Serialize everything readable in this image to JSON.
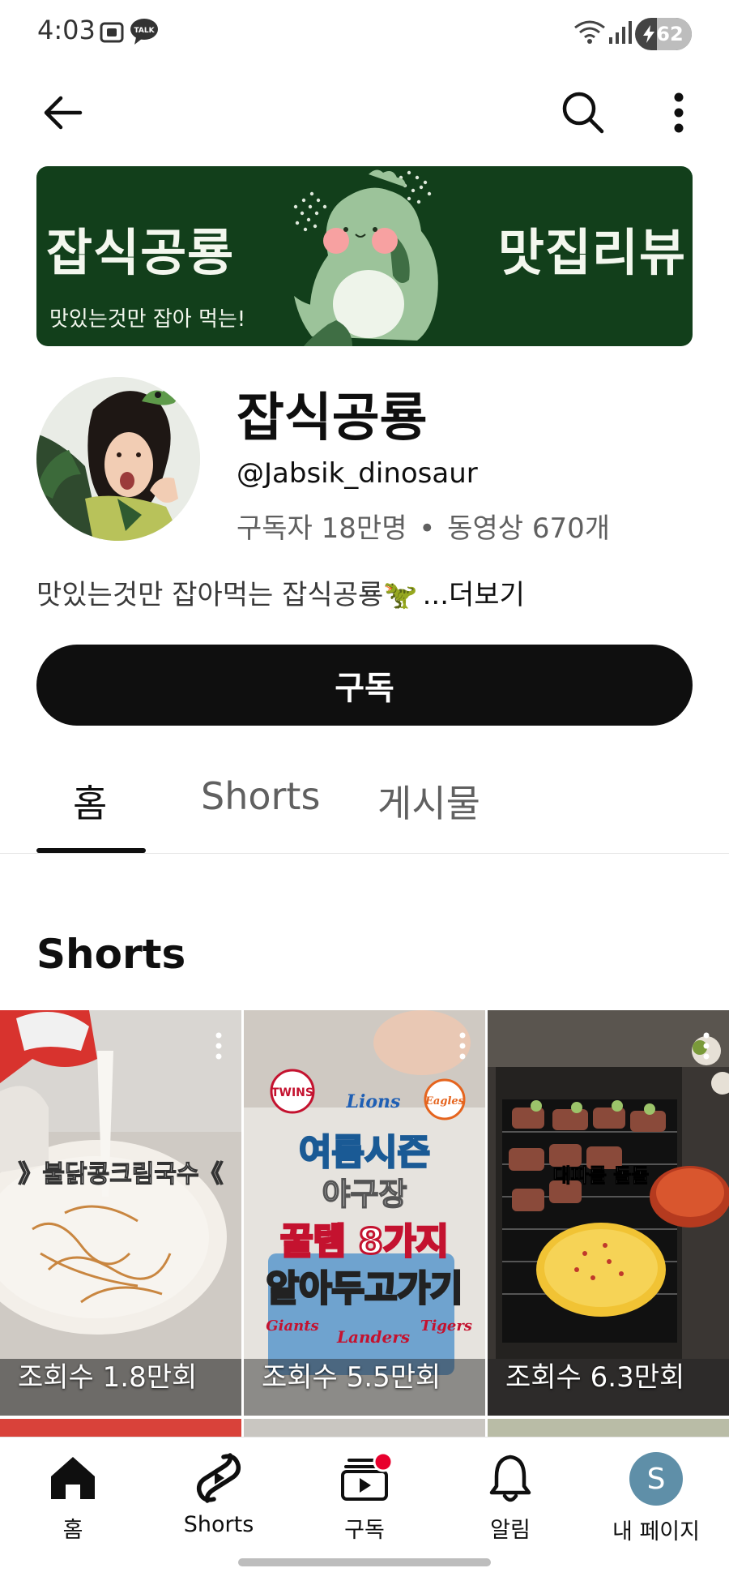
{
  "status_bar": {
    "time": "4:03",
    "battery_level": "62",
    "notif_icons": [
      "screenshot-icon",
      "kakaotalk-icon"
    ],
    "talk_badge": "TALK"
  },
  "top_bar": {
    "icons": [
      "back-arrow-icon",
      "search-icon",
      "more-vert-icon"
    ]
  },
  "banner": {
    "title_left": "잡식공룡",
    "title_right": "맛집리뷰",
    "tagline": "맛있는것만 잡아 먹는!"
  },
  "channel": {
    "name": "잡식공룡",
    "handle": "@Jabsik_dinosaur",
    "subscribers": "구독자 18만명",
    "separator": "•",
    "videos": "동영상 670개",
    "description": "맛있는것만 잡아먹는 잡식공룡🦖",
    "more_label": "...더보기"
  },
  "subscribe": {
    "label": "구독"
  },
  "tabs": [
    {
      "label": "홈",
      "active": true
    },
    {
      "label": "Shorts",
      "active": false
    },
    {
      "label": "게시물",
      "active": false
    }
  ],
  "shorts_section": {
    "title": "Shorts",
    "items": [
      {
        "views": "조회수 1.8만회",
        "overlay_text": "》불닭콩크림국수《"
      },
      {
        "views": "조회수 5.5만회",
        "overlay_lines": [
          "여름시즌",
          "야구장",
          "꿀템 8가지",
          "알아두고가기"
        ],
        "logos": [
          "TWINS",
          "Lions",
          "Eagles",
          "Giants",
          "Landers",
          "Tigers"
        ]
      },
      {
        "views": "조회수 6.3만회",
        "overlay_text": "대파를 돌돌"
      }
    ]
  },
  "bottom_nav": [
    {
      "label": "홈",
      "icon": "home-icon"
    },
    {
      "label": "Shorts",
      "icon": "shorts-icon"
    },
    {
      "label": "구독",
      "icon": "subscriptions-icon",
      "badge": true
    },
    {
      "label": "알림",
      "icon": "bell-icon"
    },
    {
      "label": "내 페이지",
      "icon": "avatar",
      "avatar_letter": "S"
    }
  ],
  "colors": {
    "banner_bg": "#123f1b",
    "subscribe_bg": "#0f0f0f",
    "badge": "#e8002d",
    "avatar_bg": "#5f8fa8"
  }
}
